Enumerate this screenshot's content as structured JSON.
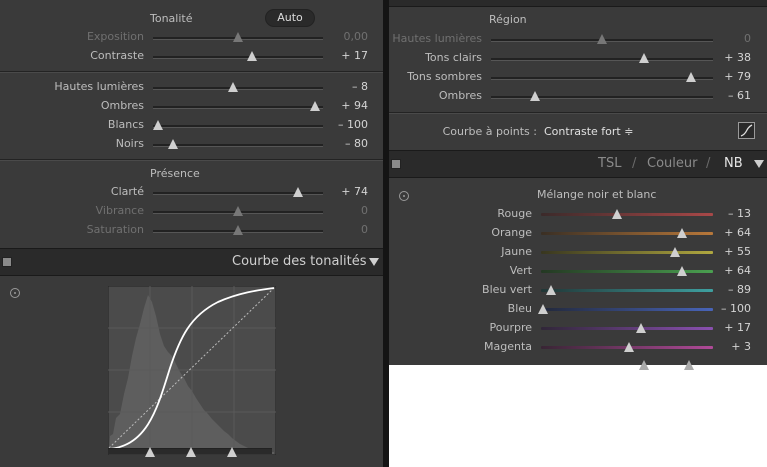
{
  "tonalite": {
    "title": "Tonalité",
    "auto_label": "Auto",
    "sliders": [
      {
        "label": "Exposition",
        "value": "0,00",
        "dim": true,
        "pos": 0.5
      },
      {
        "label": "Contraste",
        "value": "+ 17",
        "dim": false,
        "pos": 0.58
      }
    ],
    "sliders2": [
      {
        "label": "Hautes lumières",
        "value": "– 8",
        "pos": 0.47
      },
      {
        "label": "Ombres",
        "value": "+ 94",
        "pos": 0.95
      },
      {
        "label": "Blancs",
        "value": "– 100",
        "pos": 0.03
      },
      {
        "label": "Noirs",
        "value": "– 80",
        "pos": 0.12
      }
    ]
  },
  "presence": {
    "title": "Présence",
    "sliders": [
      {
        "label": "Clarté",
        "value": "+ 74",
        "dim": false,
        "pos": 0.85
      },
      {
        "label": "Vibrance",
        "value": "0",
        "dim": true,
        "pos": 0.5
      },
      {
        "label": "Saturation",
        "value": "0",
        "dim": true,
        "pos": 0.5
      }
    ]
  },
  "courbe": {
    "header": "Courbe des tonalités"
  },
  "region": {
    "title": "Région",
    "sliders": [
      {
        "label": "Hautes lumières",
        "value": "0",
        "dim": true,
        "pos": 0.5
      },
      {
        "label": "Tons clairs",
        "value": "+ 38",
        "dim": false,
        "pos": 0.69
      },
      {
        "label": "Tons sombres",
        "value": "+ 79",
        "dim": false,
        "pos": 0.9
      },
      {
        "label": "Ombres",
        "value": "– 61",
        "dim": false,
        "pos": 0.2
      }
    ],
    "point_curve_label": "Courbe à points :",
    "point_curve_value": "Contraste fort ≑"
  },
  "tabs": {
    "tsl": "TSL",
    "sep1": "/",
    "couleur": "Couleur",
    "sep2": "/",
    "nb": "NB"
  },
  "nb_mix": {
    "title": "Mélange noir et blanc",
    "sliders": [
      {
        "label": "Rouge",
        "value": "– 13",
        "pos": 0.44,
        "c1": "#3b2a2a",
        "c2": "#a84848"
      },
      {
        "label": "Orange",
        "value": "+ 64",
        "pos": 0.82,
        "c1": "#3a2f24",
        "c2": "#b8783a"
      },
      {
        "label": "Jaune",
        "value": "+ 55",
        "pos": 0.78,
        "c1": "#38361f",
        "c2": "#b0a840"
      },
      {
        "label": "Vert",
        "value": "+ 64",
        "pos": 0.82,
        "c1": "#243823",
        "c2": "#4aa050"
      },
      {
        "label": "Bleu vert",
        "value": "– 89",
        "pos": 0.06,
        "c1": "#213636",
        "c2": "#3ea0a0"
      },
      {
        "label": "Bleu",
        "value": "– 100",
        "pos": 0.01,
        "c1": "#22283a",
        "c2": "#4864b8"
      },
      {
        "label": "Pourpre",
        "value": "+ 17",
        "pos": 0.58,
        "c1": "#302638",
        "c2": "#8a50b0"
      },
      {
        "label": "Magenta",
        "value": "+ 3",
        "pos": 0.51,
        "c1": "#382534",
        "c2": "#b04a98"
      }
    ]
  }
}
